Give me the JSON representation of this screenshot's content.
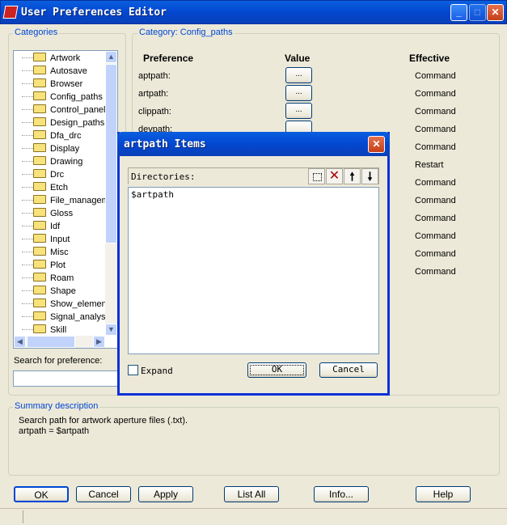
{
  "window": {
    "title": "User Preferences Editor",
    "controls": [
      "minimize",
      "maximize",
      "close"
    ]
  },
  "categories": {
    "label": "Categories",
    "items": [
      "Artwork",
      "Autosave",
      "Browser",
      "Config_paths",
      "Control_panel",
      "Design_paths",
      "Dfa_drc",
      "Display",
      "Drawing",
      "Drc",
      "Etch",
      "File_managem",
      "Gloss",
      "Idf",
      "Input",
      "Misc",
      "Plot",
      "Roam",
      "Shape",
      "Show_elemen",
      "Signal_analysi",
      "Skill"
    ],
    "search_label": "Search for preference:",
    "search_value": ""
  },
  "category_panel": {
    "label": "Category:  Config_paths",
    "headers": {
      "preference": "Preference",
      "value": "Value",
      "effective": "Effective"
    },
    "preferences": [
      {
        "name": "aptpath:",
        "value": "..."
      },
      {
        "name": "artpath:",
        "value": "..."
      },
      {
        "name": "clippath:",
        "value": "..."
      },
      {
        "name": "devpath:",
        "value": ""
      }
    ],
    "effective": [
      "Command",
      "Command",
      "Command",
      "Command",
      "Command",
      "Restart",
      "Command",
      "Command",
      "Command",
      "Command",
      "Command",
      "Command"
    ]
  },
  "summary": {
    "label": "Summary description",
    "line1": "Search path for artwork aperture files (.txt).",
    "line2": "artpath = $artpath"
  },
  "buttons": {
    "ok": "OK",
    "cancel": "Cancel",
    "apply": "Apply",
    "list_all": "List All",
    "info": "Info...",
    "help": "Help"
  },
  "dialog": {
    "title": "artpath Items",
    "directories_label": "Directories:",
    "items": [
      "$artpath"
    ],
    "toolbar": [
      "new-folder",
      "delete",
      "move-up",
      "move-down"
    ],
    "expand_label": "Expand",
    "expand_checked": false,
    "ok": "OK",
    "cancel": "Cancel"
  }
}
